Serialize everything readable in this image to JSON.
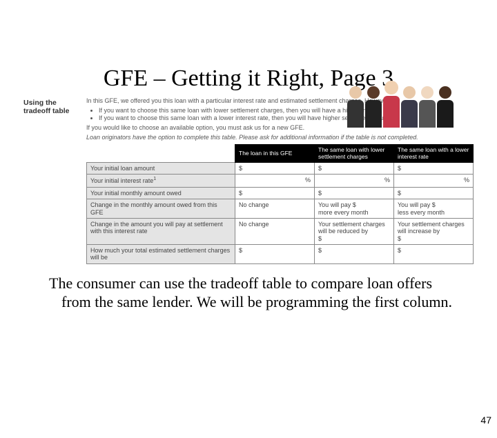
{
  "title": "GFE – Getting it Right, Page 3",
  "section_label": "Using the tradeoff table",
  "intro": {
    "lead": "In this GFE, we offered you this loan with a particular interest rate and estimated settlement charges. However:",
    "bullets": [
      "If you want to choose this same loan with lower settlement charges, then you will have a higher interest rate.",
      "If you want to choose this same loan with a lower interest rate, then you will have higher settlement charges."
    ],
    "after": "If you would like to choose an available option, you must ask us for a new GFE.",
    "italic": "Loan originators have the option to complete this table. Please ask for additional information if the table is not completed."
  },
  "table": {
    "headers": [
      "",
      "The loan in this GFE",
      "The same loan with lower settlement charges",
      "The same loan with a lower interest rate"
    ],
    "rows": [
      {
        "label": "Your initial loan amount",
        "cells": [
          "$",
          "$",
          "$"
        ]
      },
      {
        "label": "Your initial interest rate¹",
        "cells": [
          "%",
          "%",
          "%"
        ],
        "align": "right"
      },
      {
        "label": "Your initial monthly amount owed",
        "cells": [
          "$",
          "$",
          "$"
        ]
      },
      {
        "label": "Change in the monthly amount owed from this GFE",
        "cells": [
          "No change",
          "You will pay $\nmore every month",
          "You will pay $\nless every month"
        ]
      },
      {
        "label": "Change in the amount you will pay at settlement with this interest rate",
        "cells": [
          "No change",
          "Your settlement charges will be reduced by\n$",
          "Your settlement charges will increase by\n$"
        ]
      },
      {
        "label": "How much your total estimated settlement charges will be",
        "cells": [
          "$",
          "$",
          "$"
        ]
      }
    ]
  },
  "caption": "The consumer can use the tradeoff table to compare loan offers from the same lender. We will be programming the first column.",
  "page_number": "47"
}
